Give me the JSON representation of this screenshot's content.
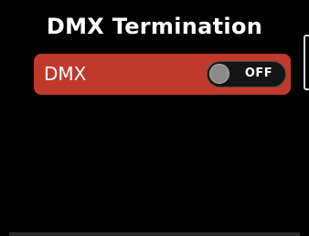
{
  "screen": {
    "title": "DMX Termination"
  },
  "setting": {
    "label": "DMX",
    "toggle_state": "OFF",
    "enabled": false
  },
  "colors": {
    "background": "#000000",
    "row_accent": "#c0392b",
    "toggle_track": "#151515",
    "text": "#ffffff"
  }
}
